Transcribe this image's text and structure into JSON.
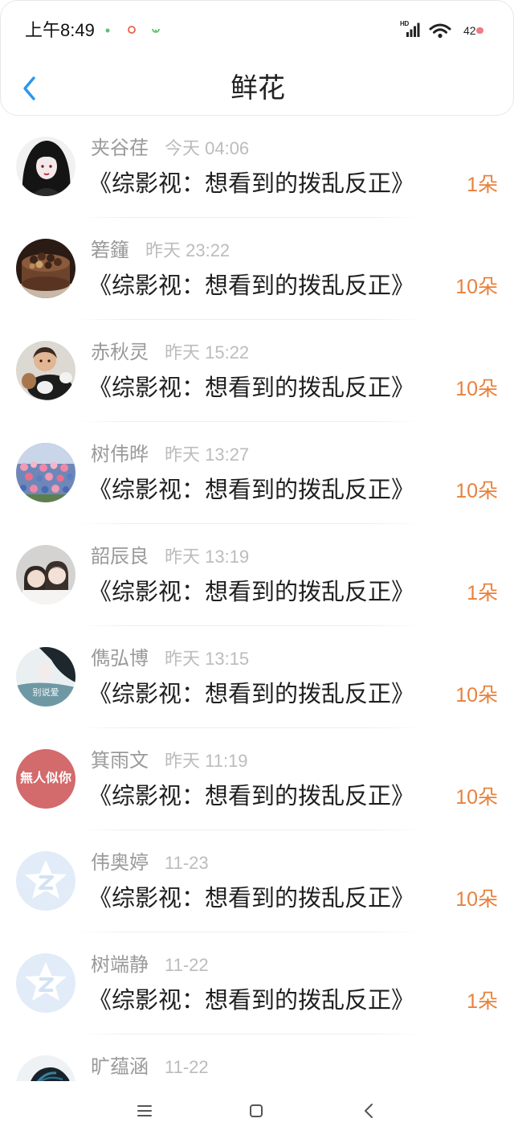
{
  "status_bar": {
    "time": "上午8:49",
    "network_label": "HD",
    "battery_level": "42",
    "icons": [
      "notification-dot-icon",
      "record-icon",
      "app-status-icon",
      "signal-icon",
      "wifi-icon",
      "battery-icon"
    ]
  },
  "header": {
    "title": "鲜花",
    "back_icon": "chevron-left-icon"
  },
  "flowers": {
    "items": [
      {
        "name": "夹谷荏",
        "time": "今天 04:06",
        "book": "《综影视：想看到的拨乱反正》",
        "count": "1朵"
      },
      {
        "name": "箬籦",
        "time": "昨天 23:22",
        "book": "《综影视：想看到的拨乱反正》",
        "count": "10朵"
      },
      {
        "name": "赤秋灵",
        "time": "昨天 15:22",
        "book": "《综影视：想看到的拨乱反正》",
        "count": "10朵"
      },
      {
        "name": "树伟晔",
        "time": "昨天 13:27",
        "book": "《综影视：想看到的拨乱反正》",
        "count": "10朵"
      },
      {
        "name": "韶辰良",
        "time": "昨天 13:19",
        "book": "《综影视：想看到的拨乱反正》",
        "count": "1朵"
      },
      {
        "name": "儁弘博",
        "time": "昨天 13:15",
        "book": "《综影视：想看到的拨乱反正》",
        "count": "10朵",
        "avatar_text": "别说爱"
      },
      {
        "name": "箕雨文",
        "time": "昨天 11:19",
        "book": "《综影视：想看到的拨乱反正》",
        "count": "10朵",
        "avatar_text": "無人似你"
      },
      {
        "name": "伟奥婷",
        "time": "11-23",
        "book": "《综影视：想看到的拨乱反正》",
        "count": "10朵"
      },
      {
        "name": "树端静",
        "time": "11-22",
        "book": "《综影视：想看到的拨乱反正》",
        "count": "1朵"
      },
      {
        "name": "旷蕴涵",
        "time": "11-22"
      }
    ]
  },
  "nav_bar": {
    "icons": [
      "menu-icon",
      "home-icon",
      "back-icon"
    ]
  },
  "colors": {
    "accent": "#2b97ee",
    "count": "#e8813c",
    "name": "#9a9a9a",
    "time": "#bcbcbc",
    "text": "#1f1f1f"
  }
}
